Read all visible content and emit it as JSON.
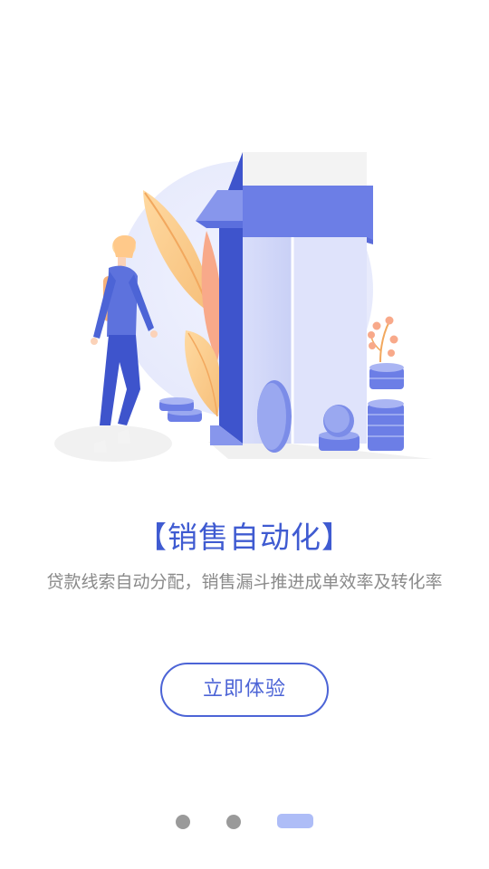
{
  "headline": "【销售自动化】",
  "subtitle": "贷款线索自动分配，销售漏斗推进成单效率及转化率",
  "cta_label": "立即体验",
  "pager": {
    "total": 3,
    "current": 3
  },
  "colors": {
    "accent": "#4c64d6",
    "headline": "#3f5bd1",
    "subtitle": "#8a8a8a",
    "dot_inactive": "#9a9a9a",
    "dot_active": "#aebdf7"
  }
}
